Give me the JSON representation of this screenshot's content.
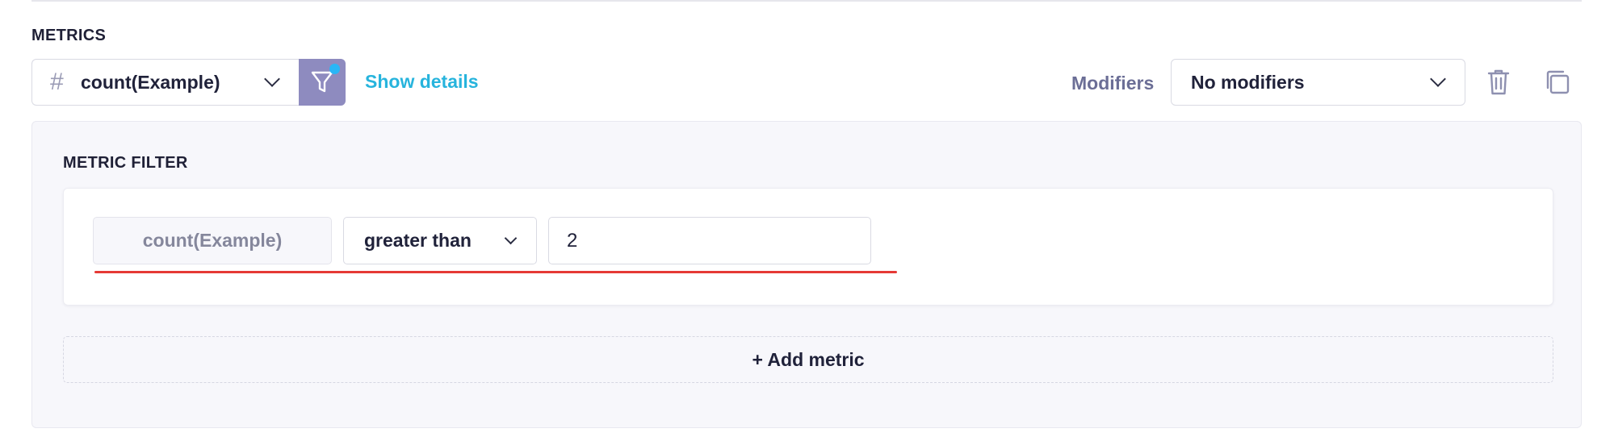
{
  "section": {
    "title": "METRICS"
  },
  "metric_select": {
    "icon": "hash-icon",
    "label": "count(Example)"
  },
  "filter_toggle": {
    "icon": "filter-icon",
    "active": true
  },
  "show_details_label": "Show details",
  "modifiers": {
    "label": "Modifiers",
    "selected": "No modifiers"
  },
  "actions": {
    "delete_icon": "trash-icon",
    "duplicate_icon": "copy-icon"
  },
  "metric_filter": {
    "title": "METRIC FILTER",
    "metric": "count(Example)",
    "operator": "greater than",
    "value": "2"
  },
  "add_metric_label": "+ Add metric",
  "colors": {
    "accent": "#27b4dd",
    "filter_button": "#8e8bbf",
    "filter_dot": "#29b6f6",
    "error": "#e53935",
    "panel_bg": "#f7f7fb"
  }
}
